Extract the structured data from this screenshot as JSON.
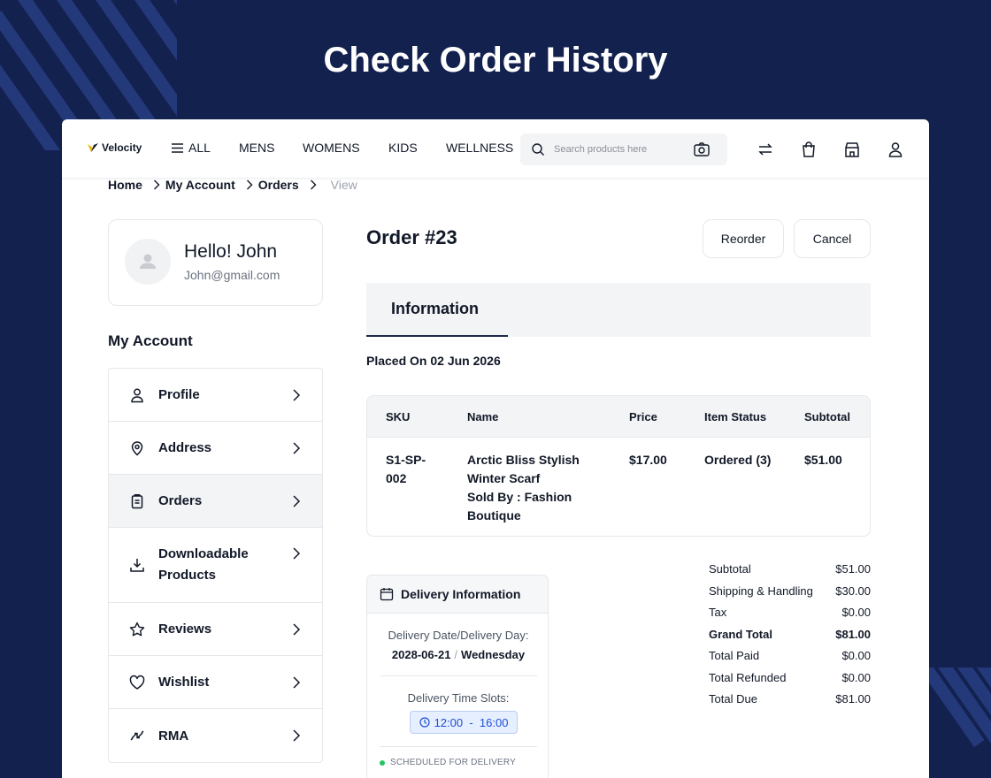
{
  "hero": {
    "title": "Check Order History"
  },
  "header": {
    "logo_text": "Velocity",
    "nav": [
      "ALL",
      "MENS",
      "WOMENS",
      "KIDS",
      "WELLNESS"
    ],
    "search_placeholder": "Search products here"
  },
  "breadcrumb": {
    "items": [
      "Home",
      "My Account",
      "Orders"
    ],
    "current": "View"
  },
  "profile": {
    "greeting": "Hello! John",
    "email": "John@gmail.com"
  },
  "sidebar": {
    "title": "My Account",
    "items": [
      {
        "label": "Profile",
        "icon": "user-icon"
      },
      {
        "label": "Address",
        "icon": "location-pin-icon"
      },
      {
        "label": "Orders",
        "icon": "clipboard-icon",
        "active": true
      },
      {
        "label": "Downloadable Products",
        "icon": "download-icon"
      },
      {
        "label": "Reviews",
        "icon": "star-icon"
      },
      {
        "label": "Wishlist",
        "icon": "heart-icon"
      },
      {
        "label": "RMA",
        "icon": "return-arrows-icon"
      }
    ]
  },
  "order": {
    "title": "Order #23",
    "reorder_label": "Reorder",
    "cancel_label": "Cancel",
    "tab_label": "Information",
    "placed_on": "Placed On 02 Jun 2026"
  },
  "items_table": {
    "headers": [
      "SKU",
      "Name",
      "Price",
      "Item Status",
      "Subtotal"
    ],
    "rows": [
      {
        "sku": "S1-SP-002",
        "name": "Arctic Bliss Stylish Winter Scarf",
        "sold_by_label": "Sold By :",
        "sold_by": "Fashion Boutique",
        "price": "$17.00",
        "status": "Ordered (3)",
        "subtotal": "$51.00"
      }
    ]
  },
  "delivery": {
    "title": "Delivery Information",
    "date_label": "Delivery Date/Delivery Day:",
    "date": "2028-06-21",
    "day": "Wednesday",
    "slot_label": "Delivery Time Slots:",
    "slot": "12:00  -  16:00",
    "status": "SCHEDULED FOR DELIVERY"
  },
  "totals": [
    {
      "label": "Subtotal",
      "value": "$51.00"
    },
    {
      "label": "Shipping & Handling",
      "value": "$30.00"
    },
    {
      "label": "Tax",
      "value": "$0.00"
    },
    {
      "label": "Grand Total",
      "value": "$81.00",
      "bold": true
    },
    {
      "label": "Total Paid",
      "value": "$0.00"
    },
    {
      "label": "Total Refunded",
      "value": "$0.00"
    },
    {
      "label": "Total Due",
      "value": "$81.00"
    }
  ],
  "colors": {
    "background": "#13214f",
    "accent": "#1e2a4a",
    "status_green": "#22c55e",
    "slot_blue": "#1d4ed8"
  }
}
